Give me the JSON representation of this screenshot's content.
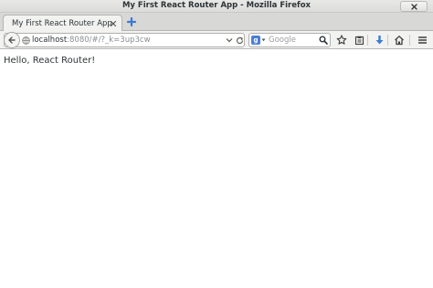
{
  "window": {
    "title": "My First React Router App - Mozilla Firefox"
  },
  "tabs": [
    {
      "label": "My First React Router App",
      "active": true
    }
  ],
  "urlbar": {
    "host": "localhost",
    "rest": ":8080/#/?_k=3up3cw"
  },
  "search": {
    "engine": "Google",
    "placeholder": "Google"
  },
  "toolbar": {
    "icons": [
      "bookmark-star-icon",
      "bookmarks-list-icon",
      "downloads-icon",
      "home-icon",
      "menu-icon"
    ]
  },
  "page": {
    "text": "Hello, React Router!"
  },
  "colors": {
    "download_arrow": "#3a7bd5",
    "engine_icon": "#4a7fd4"
  }
}
